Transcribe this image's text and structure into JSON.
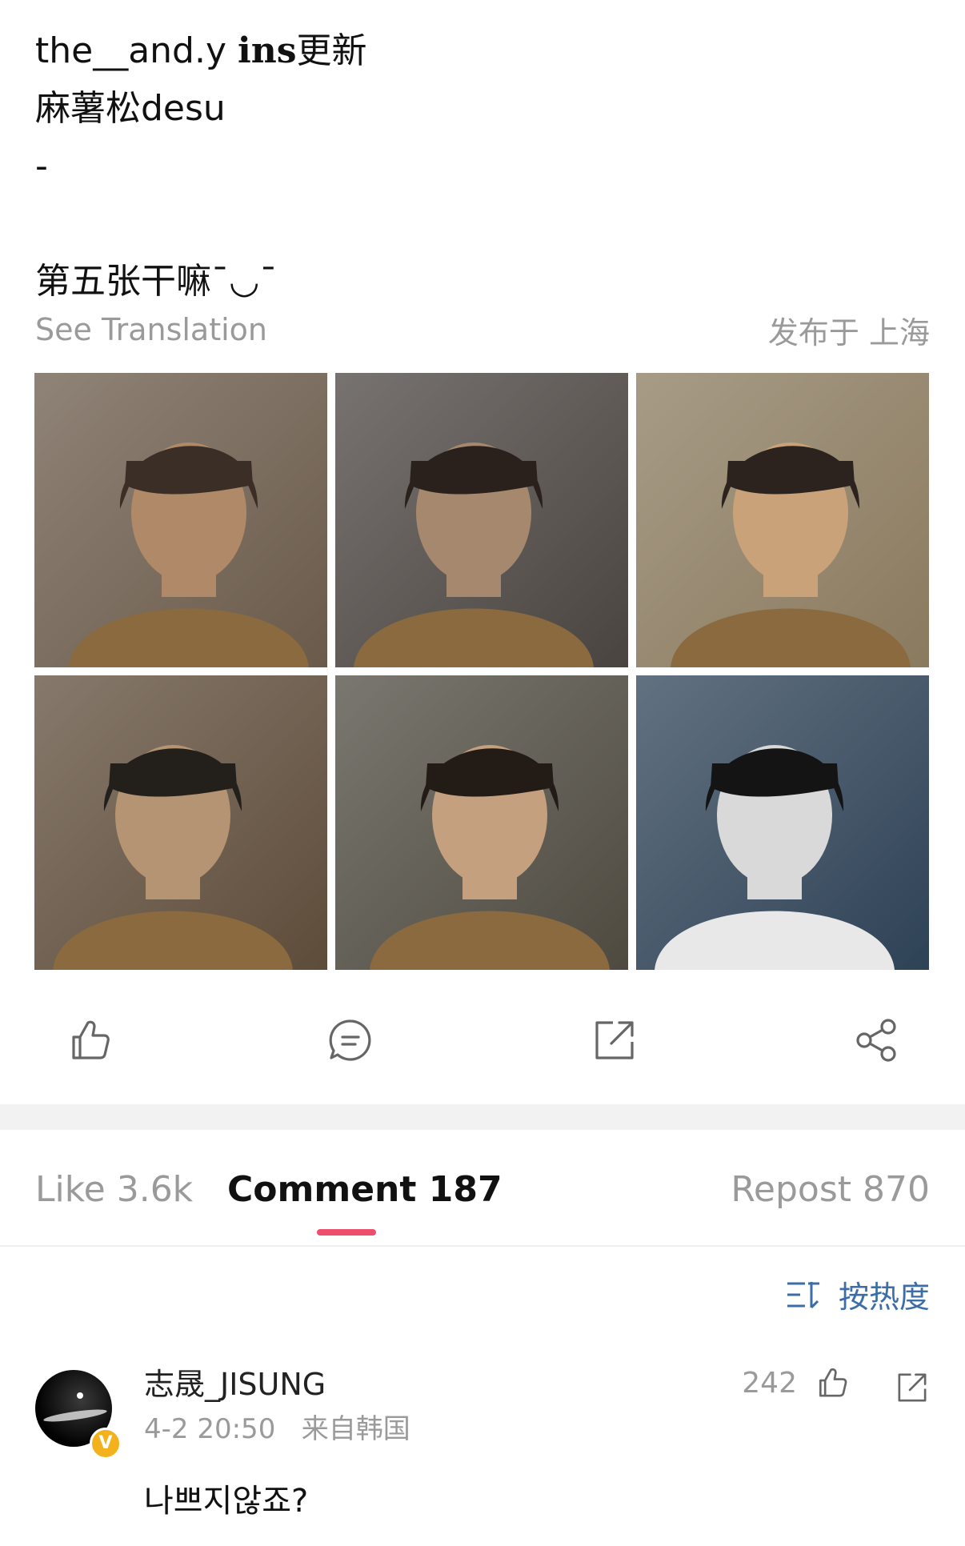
{
  "post": {
    "line1_prefix": "the__and.y ",
    "line1_bold": "ins",
    "line1_suffix": "更新",
    "line2": "麻薯松desu",
    "line3": "-",
    "line4": "第五张干嘛ˉ◡ˉ",
    "see_translation": "See Translation",
    "location": "发布于 上海"
  },
  "photos": [
    {
      "name": "photo-1",
      "palette": [
        "#6a5a4a",
        "#b08a68",
        "#3a2e26"
      ]
    },
    {
      "name": "photo-2",
      "palette": [
        "#4a4440",
        "#a6886e",
        "#2a211c"
      ]
    },
    {
      "name": "photo-3",
      "palette": [
        "#8a7a5e",
        "#c9a27a",
        "#2c231e"
      ]
    },
    {
      "name": "photo-4",
      "palette": [
        "#5e4c3a",
        "#b49472",
        "#23201c"
      ]
    },
    {
      "name": "photo-5",
      "palette": [
        "#4e4a40",
        "#c4a07e",
        "#231b16"
      ]
    },
    {
      "name": "photo-6",
      "palette": [
        "#2e4256",
        "#d9d9d9",
        "#141414"
      ]
    }
  ],
  "actions": {
    "like_icon": "thumbs-up-icon",
    "comment_icon": "comment-icon",
    "repost_icon": "repost-icon",
    "share_icon": "share-icon"
  },
  "tabs": {
    "like": "Like 3.6k",
    "comment": "Comment 187",
    "repost": "Repost 870"
  },
  "sort": {
    "label": "按热度"
  },
  "comment": {
    "user": "志晟_JISUNG",
    "meta": "4-2 20:50   来自韩国",
    "body": "나쁘지않죠?",
    "likes": "242",
    "badge": "V"
  },
  "colors": {
    "accent": "#ee4d6b",
    "link": "#3b6ea8",
    "muted": "#9a9a9a"
  }
}
